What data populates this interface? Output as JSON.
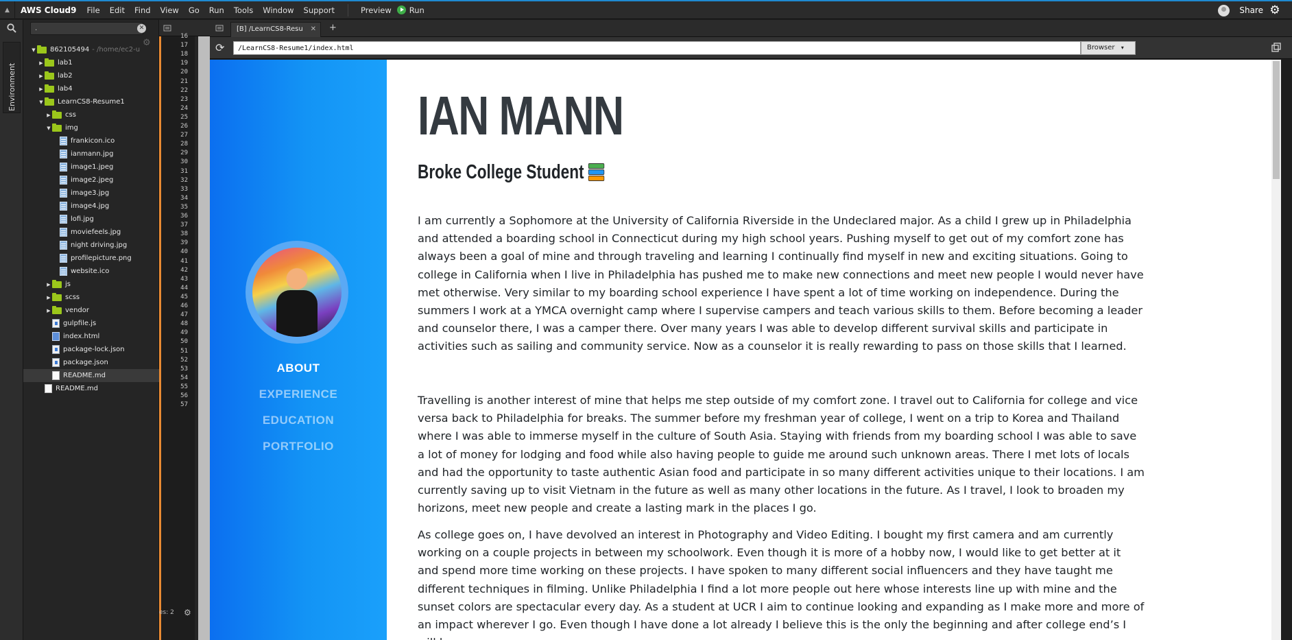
{
  "menubar": {
    "brand": "AWS Cloud9",
    "items": [
      "File",
      "Edit",
      "Find",
      "View",
      "Go",
      "Run",
      "Tools",
      "Window",
      "Support"
    ],
    "preview_label": "Preview",
    "run_label": "Run",
    "share_label": "Share"
  },
  "rail": {
    "environment_label": "Environment"
  },
  "tree": {
    "search_value": ".",
    "rows": [
      {
        "indent": 0,
        "type": "folder",
        "expanded": true,
        "name": "862105494",
        "extra": "- /home/ec2-u"
      },
      {
        "indent": 1,
        "type": "folder",
        "expanded": false,
        "name": "lab1",
        "extra": ""
      },
      {
        "indent": 1,
        "type": "folder",
        "expanded": false,
        "name": "lab2",
        "extra": ""
      },
      {
        "indent": 1,
        "type": "folder",
        "expanded": false,
        "name": "lab4",
        "extra": ""
      },
      {
        "indent": 1,
        "type": "folder",
        "expanded": true,
        "name": "LearnCS8-Resume1",
        "extra": ""
      },
      {
        "indent": 2,
        "type": "folder",
        "expanded": false,
        "name": "css",
        "extra": ""
      },
      {
        "indent": 2,
        "type": "folder",
        "expanded": true,
        "name": "img",
        "extra": ""
      },
      {
        "indent": 3,
        "type": "img",
        "name": "frankicon.ico",
        "extra": ""
      },
      {
        "indent": 3,
        "type": "img",
        "name": "ianmann.jpg",
        "extra": ""
      },
      {
        "indent": 3,
        "type": "img",
        "name": "image1.jpeg",
        "extra": ""
      },
      {
        "indent": 3,
        "type": "img",
        "name": "image2.jpeg",
        "extra": ""
      },
      {
        "indent": 3,
        "type": "img",
        "name": "image3.jpg",
        "extra": ""
      },
      {
        "indent": 3,
        "type": "img",
        "name": "image4.jpg",
        "extra": ""
      },
      {
        "indent": 3,
        "type": "img",
        "name": "lofi.jpg",
        "extra": ""
      },
      {
        "indent": 3,
        "type": "img",
        "name": "moviefeels.jpg",
        "extra": ""
      },
      {
        "indent": 3,
        "type": "img",
        "name": "night driving.jpg",
        "extra": ""
      },
      {
        "indent": 3,
        "type": "img",
        "name": "profilepicture.png",
        "extra": ""
      },
      {
        "indent": 3,
        "type": "img",
        "name": "website.ico",
        "extra": ""
      },
      {
        "indent": 2,
        "type": "folder",
        "expanded": false,
        "name": "js",
        "extra": ""
      },
      {
        "indent": 2,
        "type": "folder",
        "expanded": false,
        "name": "scss",
        "extra": ""
      },
      {
        "indent": 2,
        "type": "folder",
        "expanded": false,
        "name": "vendor",
        "extra": ""
      },
      {
        "indent": 2,
        "type": "js",
        "name": "gulpfile.js",
        "extra": ""
      },
      {
        "indent": 2,
        "type": "html",
        "name": "index.html",
        "extra": ""
      },
      {
        "indent": 2,
        "type": "js",
        "name": "package-lock.json",
        "extra": ""
      },
      {
        "indent": 2,
        "type": "js",
        "name": "package.json",
        "extra": ""
      },
      {
        "indent": 2,
        "type": "md",
        "name": "README.md",
        "extra": "",
        "selected": true
      },
      {
        "indent": 1,
        "type": "md",
        "name": "README.md",
        "extra": ""
      }
    ]
  },
  "editor": {
    "line_numbers": [
      "16",
      "17",
      "18",
      "19",
      "20",
      "21",
      "22",
      "23",
      "24",
      "25",
      "26",
      "27",
      "28",
      "29",
      "30",
      "31",
      "32",
      "33",
      "34",
      "35",
      "36",
      "37",
      "38",
      "39",
      "40",
      "41",
      "42",
      "43",
      "44",
      "45",
      "46",
      "47",
      "48",
      "49",
      "50",
      "51",
      "52",
      "53",
      "54",
      "55",
      "56",
      "57"
    ],
    "status_fragment": "es: 2"
  },
  "preview": {
    "tab_title": "[B] /LearnCS8-Resu",
    "url": "/LearnCS8-Resume1/index.html",
    "browser_select": "Browser"
  },
  "site": {
    "name": "IAN MANN",
    "subtitle": "Broke College Student",
    "nav": [
      "ABOUT",
      "EXPERIENCE",
      "EDUCATION",
      "PORTFOLIO"
    ],
    "paragraphs": [
      "I am currently a Sophomore at the University of California Riverside in the Undeclared major. As a child I grew up in Philadelphia and attended a boarding school in Connecticut during my high school years. Pushing myself to get out of my comfort zone has always been a goal of mine and through traveling and learning I continually find myself in new and exciting situations. Going to college in California when I live in Philadelphia has pushed me to make new connections and meet new people I would never have met otherwise. Very similar to my boarding school experience I have spent a lot of time working on independence. During the summers I work at a YMCA overnight camp where I supervise campers and teach various skills to them. Before becoming a leader and counselor there, I was a camper there. Over many years I was able to develop different survival skills and participate in activities such as sailing and community service. Now as a counselor it is really rewarding to pass on those skills that I learned.",
      "Travelling is another interest of mine that helps me step outside of my comfort zone. I travel out to California for college and vice versa back to Philadelphia for breaks. The summer before my freshman year of college, I went on a trip to Korea and Thailand where I was able to immerse myself in the culture of South Asia. Staying with friends from my boarding school I was able to save a lot of money for lodging and food while also having people to guide me around such unknown areas. There I met lots of locals and had the opportunity to taste authentic Asian food and participate in so many different activities unique to their locations. I am currently saving up to visit Vietnam in the future as well as many other locations in the future. As I travel, I look to broaden my horizons, meet new people and create a lasting mark in the places I go.",
      "As college goes on, I have devolved an interest in Photography and Video Editing. I bought my first camera and am currently working on a couple projects in between my schoolwork. Even though it is more of a hobby now, I would like to get better at it and spend more time working on these projects. I have spoken to many different social influencers and they have taught me different techniques in filming. Unlike Philadelphia I find a lot more people out here whose interests line up with mine and the sunset colors are spectacular every day. As a student at UCR I aim to continue looking and expanding as I make more and more of an impact wherever I go. Even though I have done a lot already I believe this is the only the beginning and after college end’s I will have more"
    ]
  },
  "colors": {
    "accent_top": "#1f8ad2",
    "folder": "#9bc71b",
    "gutter_marker": "#e98a33",
    "site_sidebar": "#0b6ff0",
    "heading": "#343a40"
  }
}
